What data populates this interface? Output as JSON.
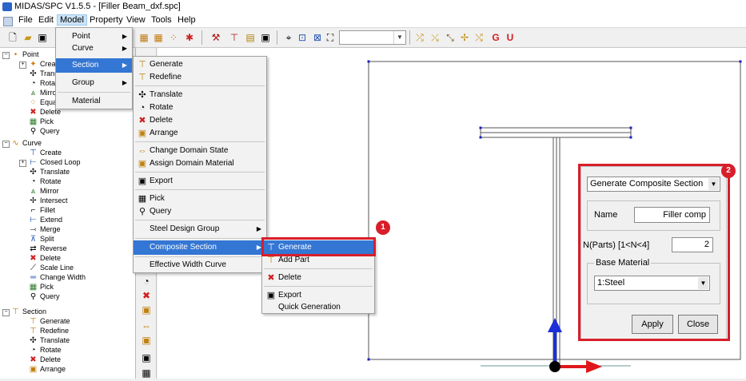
{
  "window": {
    "title": "MIDAS/SPC V1.5.5 - [Filler Beam_dxf.spc]"
  },
  "menubar": {
    "items": [
      "File",
      "Edit",
      "Model",
      "Property",
      "View",
      "Tools",
      "Help"
    ]
  },
  "model_menu": {
    "items": [
      {
        "label": "Point",
        "submenu": true
      },
      {
        "label": "Curve",
        "submenu": true
      },
      {
        "label": "Section",
        "submenu": true
      },
      {
        "label": "Group",
        "submenu": true
      },
      {
        "label": "Material",
        "submenu": false
      }
    ]
  },
  "section_menu": {
    "items": [
      {
        "label": "Generate"
      },
      {
        "label": "Redefine"
      },
      {
        "label": "Translate"
      },
      {
        "label": "Rotate"
      },
      {
        "label": "Delete"
      },
      {
        "label": "Arrange"
      },
      {
        "label": "Change Domain State"
      },
      {
        "label": "Assign Domain Material"
      },
      {
        "label": "Export"
      },
      {
        "label": "Pick"
      },
      {
        "label": "Query"
      },
      {
        "label": "Steel Design Group"
      },
      {
        "label": "Composite Section"
      },
      {
        "label": "Effective Width Curve"
      }
    ]
  },
  "composite_menu": {
    "items": [
      {
        "label": "Generate"
      },
      {
        "label": "Add Part"
      },
      {
        "label": "Delete"
      },
      {
        "label": "Export"
      },
      {
        "label": "Quick Generation"
      }
    ]
  },
  "tree": {
    "point": {
      "label": "Point",
      "children": [
        "Create",
        "Trans",
        "Rotat",
        "Mirro",
        "Equa",
        "Delete",
        "Pick",
        "Query"
      ]
    },
    "curve": {
      "label": "Curve",
      "children": [
        "Create",
        "Closed Loop",
        "Translate",
        "Rotate",
        "Mirror",
        "Intersect",
        "Fillet",
        "Extend",
        "Merge",
        "Split",
        "Reverse",
        "Delete",
        "Scale Line",
        "Change Width",
        "Pick",
        "Query"
      ]
    },
    "section": {
      "label": "Section",
      "children": [
        "Generate",
        "Redefine",
        "Translate",
        "Rotate",
        "Delete",
        "Arrange"
      ]
    }
  },
  "panel": {
    "dropdown": "Generate Composite Section",
    "name_label": "Name",
    "name_value": "Filler comp",
    "nparts_label": "N(Parts) [1<N<4]",
    "nparts_value": "2",
    "base_material_label": "Base Material",
    "base_material_value": "1:Steel",
    "apply": "Apply",
    "close": "Close"
  },
  "badges": {
    "one": "1",
    "two": "2"
  },
  "colors": {
    "highlight": "#3476d3",
    "callout": "#d81e2a",
    "axis_y": "#1b2fd8",
    "axis_x": "#e0161b"
  }
}
